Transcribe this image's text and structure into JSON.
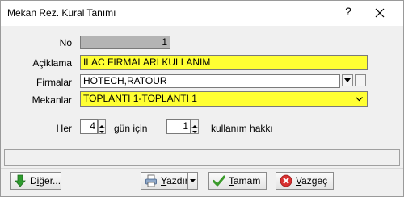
{
  "window": {
    "title": "Mekan Rez. Kural Tanımı",
    "help": "?"
  },
  "form": {
    "no_label": "No",
    "no_value": "1",
    "aciklama_label": "Açiklama",
    "aciklama_value": "ILAC FIRMALARI KULLANIM",
    "firmalar_label": "Firmalar",
    "firmalar_value": "HOTECH,RATOUR",
    "mekanlar_label": "Mekanlar",
    "mekanlar_value": "TOPLANTI 1-TOPLANTI 1",
    "her_label": "Her",
    "her_value": "4",
    "gun_icin_label": "gün için",
    "kullanim_value": "1",
    "kullanim_label": "kullanım hakkı",
    "ellipsis": "..."
  },
  "buttons": {
    "diger_pre": "D",
    "diger_mn": "i",
    "diger_post": "ğer...",
    "yazdir_mn": "Y",
    "yazdir_post": "azdır",
    "tamam_mn": "T",
    "tamam_post": "amam",
    "vazgec_mn": "V",
    "vazgec_post": "azgeç"
  },
  "colors": {
    "required_field": "#ffff33",
    "readonly_field": "#b4b4b4"
  }
}
